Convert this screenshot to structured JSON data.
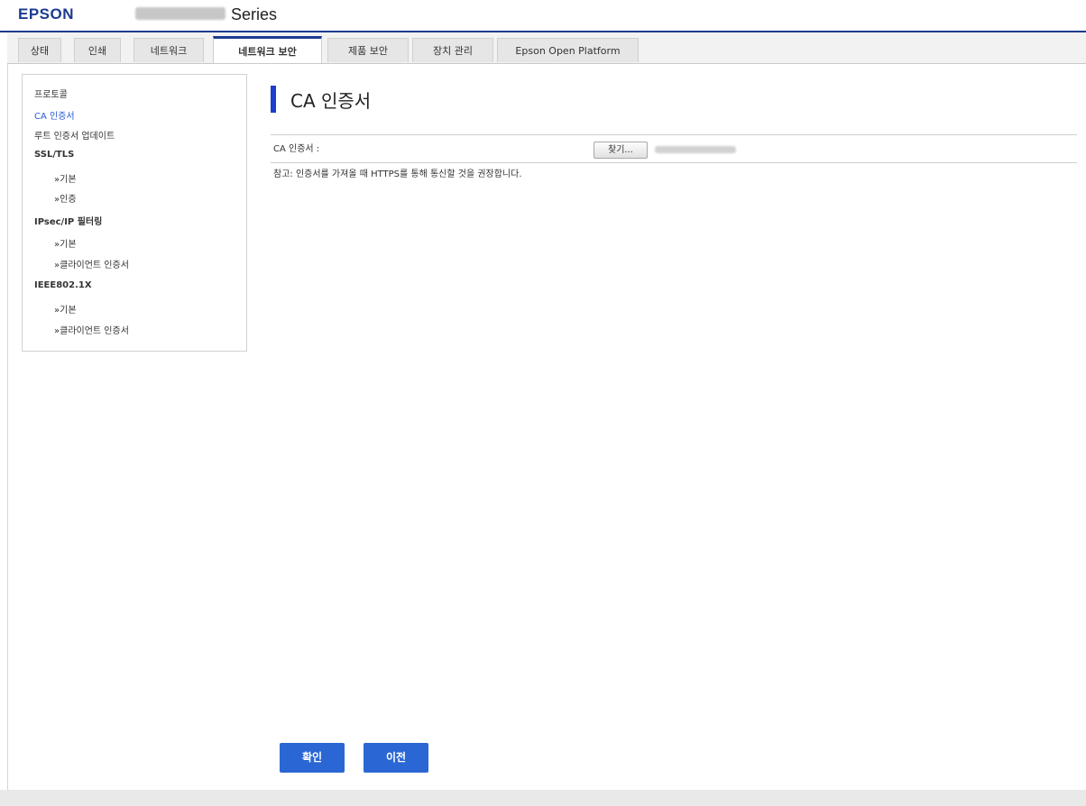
{
  "header": {
    "brand": "EPSON",
    "series": "Series"
  },
  "tabs": [
    {
      "label": "상태"
    },
    {
      "label": "인쇄"
    },
    {
      "label": "네트워크"
    },
    {
      "label": "네트워크 보안",
      "active": true
    },
    {
      "label": "제품 보안"
    },
    {
      "label": "장치 관리"
    },
    {
      "label": "Epson Open Platform"
    }
  ],
  "sidebar": {
    "items": [
      {
        "label": "프로토콜"
      },
      {
        "label": "CA 인증서",
        "selected": true
      },
      {
        "label": "루트 인증서 업데이트"
      },
      {
        "label": "SSL/TLS"
      },
      {
        "label": "»기본"
      },
      {
        "label": "»인증"
      },
      {
        "label": "IPsec/IP 필터링"
      },
      {
        "label": "»기본"
      },
      {
        "label": "»클라이언트 인증서"
      },
      {
        "label": "IEEE802.1X"
      },
      {
        "label": "»기본"
      },
      {
        "label": "»클라이언트 인증서"
      }
    ]
  },
  "main": {
    "title": "CA 인증서",
    "field_label": "CA 인증서 :",
    "browse_label": "찾기...",
    "note": "참고: 인증서를 가져올 때 HTTPS를 통해 통신할 것을 권장합니다.",
    "ok_label": "확인",
    "back_label": "이전"
  },
  "colors": {
    "accent": "#1d3fcf",
    "brand": "#1d3a8f",
    "button": "#2a67d4",
    "link": "#2a5bd7"
  }
}
